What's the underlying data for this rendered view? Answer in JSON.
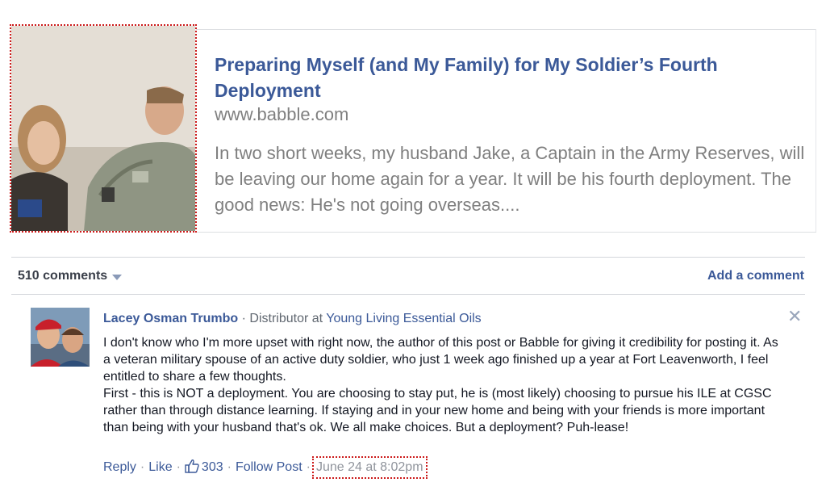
{
  "link_preview": {
    "title": "Preparing Myself (and My Family) for My Soldier’s Fourth Deployment",
    "domain": "www.babble.com",
    "description": "In two short weeks, my husband Jake, a Captain in the Army Reserves, will be leaving our home again for a year. It will be his fourth deployment. The good news: He's not going overseas...."
  },
  "comments_bar": {
    "count_label": "510 comments",
    "add_comment_label": "Add a comment"
  },
  "comment": {
    "author": "Lacey Osman Trumbo",
    "separator": "·",
    "role": "Distributor",
    "at_word": "at",
    "employer": "Young Living Essential Oils",
    "body_paragraph_1": "I don't know who I'm more upset with right now, the author of this post or Babble for giving it credibility for posting it. As a veteran military spouse of an active duty soldier, who just 1 week ago finished up a year at Fort Leavenworth, I feel entitled to share a few thoughts.",
    "body_paragraph_2": "First - this is NOT a deployment. You are choosing to stay put, he is (most likely) choosing to pursue his ILE at CGSC rather than through distance learning. If staying and in your new home and being with your friends is more important than being with your husband that's ok. We all make choices. But a deployment? Puh-lease!",
    "actions": {
      "reply": "Reply",
      "like": "Like",
      "like_count": "303",
      "follow": "Follow Post",
      "timestamp": "June 24 at 8:02pm"
    }
  },
  "icons": {
    "close": "close-icon",
    "like": "thumbs-up-icon",
    "dropdown": "chevron-down-icon"
  },
  "colors": {
    "link_blue": "#3b5998",
    "meta_gray": "#90949c",
    "highlight_red": "#cc1a1a"
  }
}
